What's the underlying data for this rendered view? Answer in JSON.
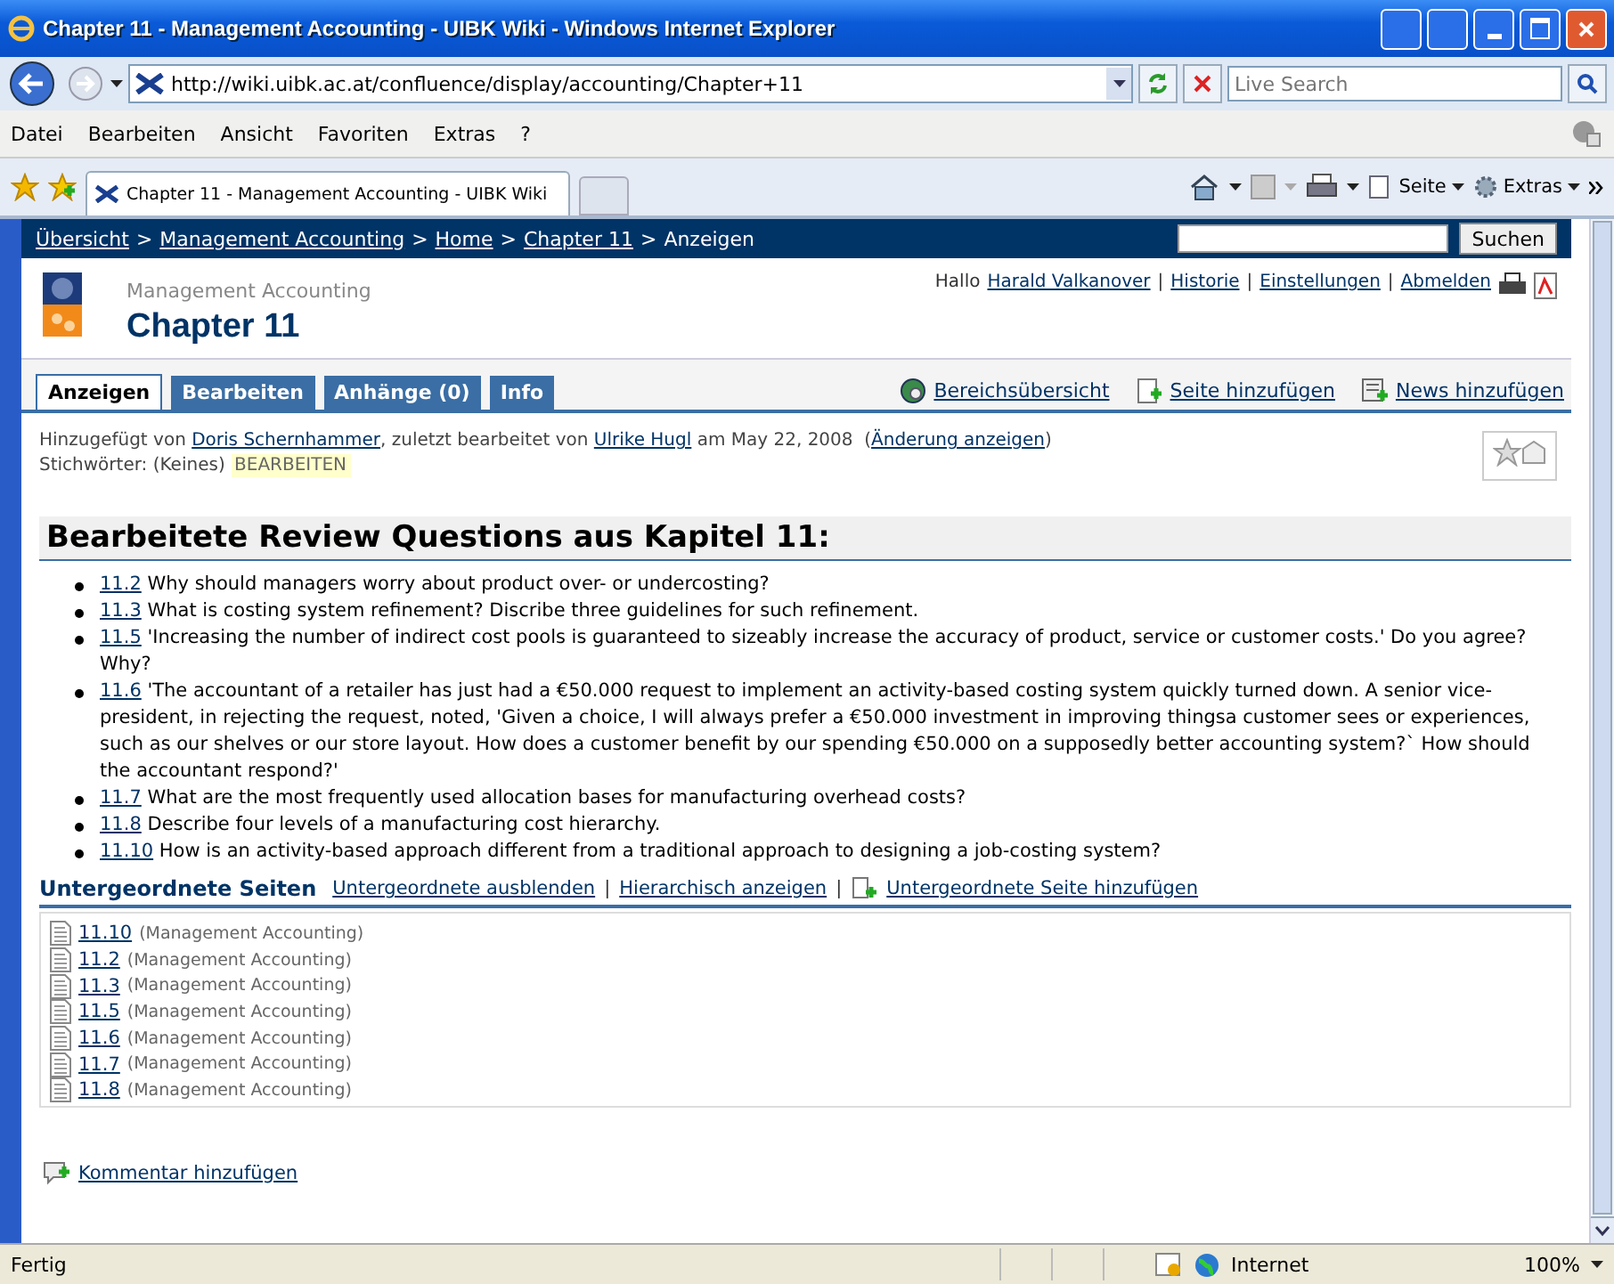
{
  "window": {
    "title": "Chapter 11 - Management Accounting - UIBK Wiki - Windows Internet Explorer"
  },
  "address_bar": {
    "url": "http://wiki.uibk.ac.at/confluence/display/accounting/Chapter+11",
    "search_placeholder": "Live Search"
  },
  "menu": [
    "Datei",
    "Bearbeiten",
    "Ansicht",
    "Favoriten",
    "Extras",
    "?"
  ],
  "browser_tab": {
    "title": "Chapter 11 - Management Accounting - UIBK Wiki"
  },
  "command_bar": [
    "Seite",
    "Extras"
  ],
  "breadcrumb": [
    {
      "kind": "link",
      "text": "Übersicht"
    },
    {
      "kind": "sep",
      "text": ">"
    },
    {
      "kind": "link",
      "text": "Management Accounting"
    },
    {
      "kind": "sep",
      "text": ">"
    },
    {
      "kind": "link",
      "text": "Home"
    },
    {
      "kind": "sep",
      "text": ">"
    },
    {
      "kind": "link",
      "text": "Chapter 11"
    },
    {
      "kind": "sep",
      "text": ">"
    },
    {
      "kind": "current",
      "text": "Anzeigen"
    }
  ],
  "search_button": "Suchen",
  "space_name": "Management Accounting",
  "page_title": "Chapter 11",
  "user_links": [
    {
      "kind": "text",
      "text": "Hallo"
    },
    {
      "kind": "link",
      "text": "Harald Valkanover"
    },
    {
      "kind": "sep",
      "text": "|"
    },
    {
      "kind": "link",
      "text": "Historie"
    },
    {
      "kind": "sep",
      "text": "|"
    },
    {
      "kind": "link",
      "text": "Einstellungen"
    },
    {
      "kind": "sep",
      "text": "|"
    },
    {
      "kind": "link",
      "text": "Abmelden"
    }
  ],
  "page_tabs": [
    {
      "label": "Anzeigen",
      "selected": true
    },
    {
      "label": "Bearbeiten",
      "selected": false
    },
    {
      "label": "Anhänge (0)",
      "selected": false
    },
    {
      "label": "Info",
      "selected": false
    }
  ],
  "page_actions": [
    {
      "label": "Bereichsübersicht",
      "kind": "globe"
    },
    {
      "label": "Seite hinzufügen",
      "kind": "page"
    },
    {
      "label": "News hinzufügen",
      "kind": "news"
    }
  ],
  "page_info": [
    {
      "kind": "text",
      "text": "Hinzugefügt von "
    },
    {
      "kind": "link",
      "text": "Doris Schernhammer"
    },
    {
      "kind": "text",
      "text": ", zuletzt bearbeitet von "
    },
    {
      "kind": "link",
      "text": "Ulrike Hugl"
    },
    {
      "kind": "text",
      "text": " am May 22, 2008  ("
    },
    {
      "kind": "link",
      "text": "Änderung anzeigen"
    },
    {
      "kind": "text",
      "text": ")"
    }
  ],
  "labels": {
    "text": "Stichwörter: (Keines)",
    "edit": "BEARBEITEN"
  },
  "heading": "Bearbeitete Review Questions aus Kapitel 11:",
  "questions": [
    {
      "number": "11.2",
      "text": "Why should managers worry about product over- or undercosting?"
    },
    {
      "number": "11.3",
      "text": "What is costing system refinement? Discribe three guidelines for such refinement."
    },
    {
      "number": "11.5",
      "text": "'Increasing the number of  indirect cost pools is guaranteed to sizeably increase the accuracy of product, service or customer costs.' Do you agree? Why?"
    },
    {
      "number": "11.6",
      "text": "'The accountant of a retailer has just had a €50.000 request to implement an activity-based costing system quickly turned down. A senior vice-president, in rejecting the request, noted, 'Given a choice, I will always prefer a €50.000 investment in improving thingsa customer sees or experiences, such as our shelves or our store layout. How does a customer benefit by our spending €50.000 on a supposedly better accounting system?` How should the accountant respond?'"
    },
    {
      "number": "11.7",
      "text": "What are the most frequently used allocation bases for manufacturing overhead costs?"
    },
    {
      "number": "11.8",
      "text": "Describe four levels of a manufacturing cost hierarchy."
    },
    {
      "number": "11.10",
      "text": "How is an activity-based approach different from a traditional approach to designing a job-costing system?"
    }
  ],
  "children": {
    "title": "Untergeordnete Seiten",
    "links": [
      {
        "kind": "link",
        "text": "Untergeordnete ausblenden"
      },
      {
        "kind": "sep",
        "text": "|"
      },
      {
        "kind": "link",
        "text": "Hierarchisch anzeigen"
      },
      {
        "kind": "sep",
        "text": "|"
      },
      {
        "kind": "add",
        "text": "Untergeordnete Seite hinzufügen"
      }
    ],
    "pages": [
      {
        "name": "11.10",
        "space": "(Management Accounting)"
      },
      {
        "name": "11.2",
        "space": "(Management Accounting)"
      },
      {
        "name": "11.3",
        "space": "(Management Accounting)"
      },
      {
        "name": "11.5",
        "space": "(Management Accounting)"
      },
      {
        "name": "11.6",
        "space": "(Management Accounting)"
      },
      {
        "name": "11.7",
        "space": "(Management Accounting)"
      },
      {
        "name": "11.8",
        "space": "(Management Accounting)"
      }
    ]
  },
  "add_comment": "Kommentar hinzufügen",
  "status_bar": {
    "text": "Fertig",
    "zone": "Internet",
    "zoom": "100%"
  }
}
